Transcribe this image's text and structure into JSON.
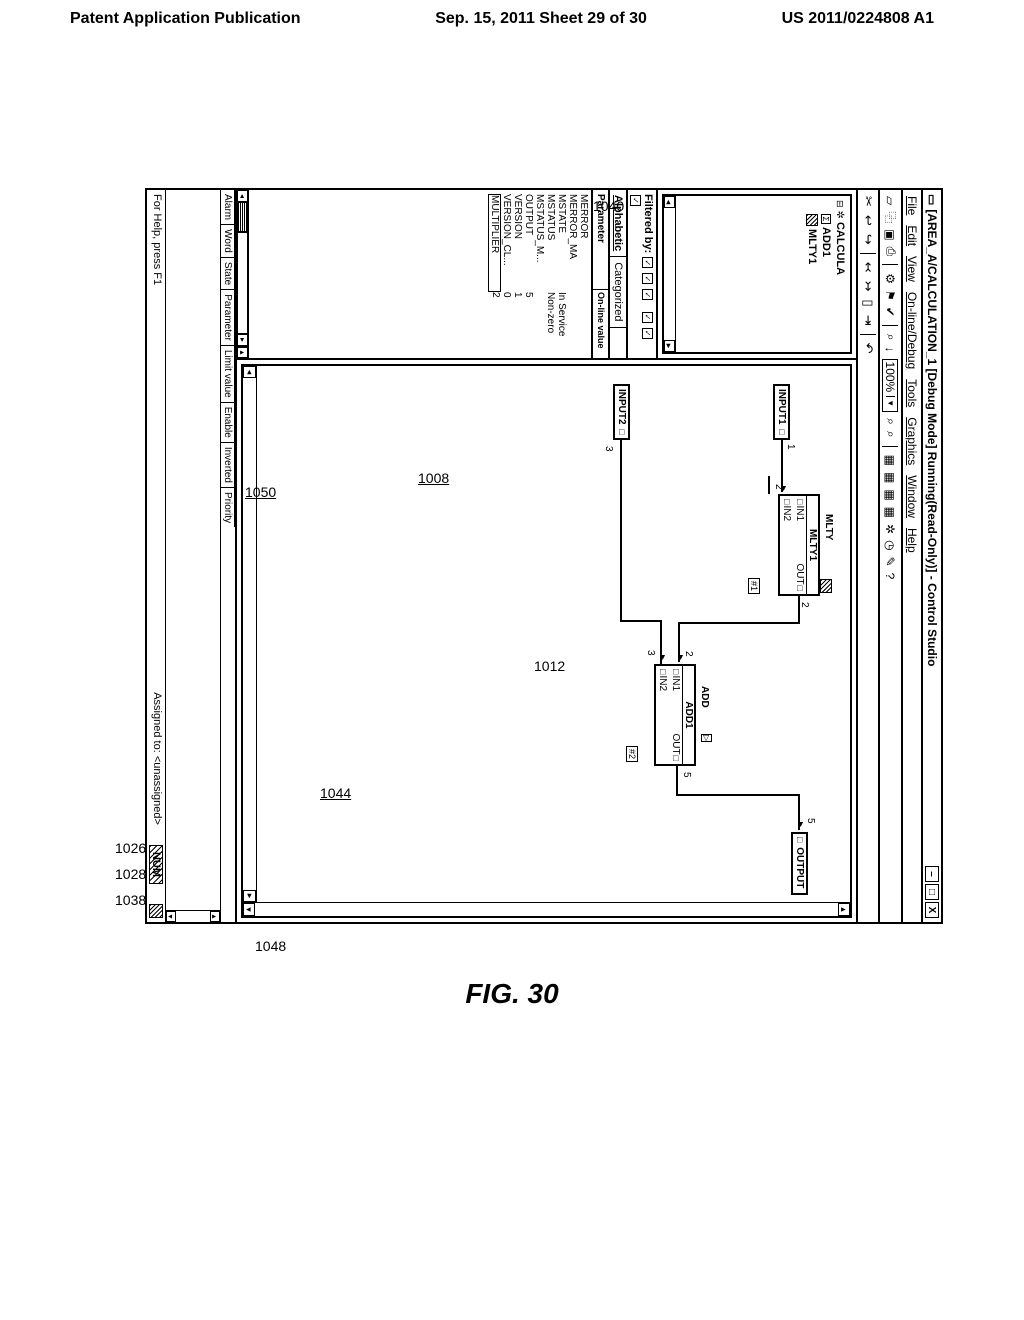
{
  "page_header": {
    "left": "Patent Application Publication",
    "center": "Sep. 15, 2011  Sheet 29 of 30",
    "right": "US 2011/0224808 A1"
  },
  "figure_label": "FIG. 30",
  "annotations": {
    "top": "1040",
    "a1026": "1026",
    "a1028": "1028",
    "a1038": "1038",
    "a1048": "1048",
    "a1050": "1050",
    "a1008": "1008",
    "a1012": "1012",
    "a1044": "1044"
  },
  "window": {
    "title": "[AREA_A/CALCULATION_1 [Debug Mode] Running(Read-Only)] - Control Studio",
    "menu": [
      "File",
      "Edit",
      "View",
      "On-line/Debug",
      "Tools",
      "Graphics",
      "Window",
      "Help"
    ],
    "zoom": "100%"
  },
  "tree": {
    "root": "CALCULA",
    "n1_box": "Σ",
    "n1": "ADD1",
    "n2": "MLTY1"
  },
  "filter": {
    "label": "Filtered by:"
  },
  "cattabs": {
    "t1": "Alphabetic",
    "t2": "Categorized"
  },
  "param_head": {
    "c1": "Parameter",
    "c2": "On-line value"
  },
  "params": [
    {
      "nm": "MERROR",
      "vl": ""
    },
    {
      "nm": "MERROR_MA",
      "vl": ""
    },
    {
      "nm": "MSTATE",
      "vl": "In Service"
    },
    {
      "nm": "MSTATUS",
      "vl": "Non-zero"
    },
    {
      "nm": "MSTATUS_M...",
      "vl": ""
    },
    {
      "nm": "OUTPUT",
      "vl": "5"
    },
    {
      "nm": "VERSION",
      "vl": "1"
    },
    {
      "nm": "VERSION_CL...",
      "vl": "0"
    },
    {
      "nm": "MULTIPLIER",
      "vl": "2"
    }
  ],
  "canvas": {
    "input1": "INPUT1",
    "input2": "INPUT2",
    "mlty_t": "MLTY",
    "mlty": "MLTY1",
    "mlty_in1": "IN1",
    "mlty_in2": "IN2",
    "mlty_out": "OUT",
    "add_t": "ADD",
    "add": "ADD1",
    "add_in1": "IN1",
    "add_in2": "IN2",
    "add_out": "OUT",
    "output": "OUTPUT",
    "n1": "1",
    "n2": "2",
    "n3": "3",
    "n4": "5",
    "h1": "#1",
    "h2": "#2",
    "nOut2": "2",
    "nOut5": "5"
  },
  "low_cols": [
    "Alarm",
    "Word",
    "State",
    "Parameter",
    "Limit value",
    "Enable",
    "Inverted",
    "Priority"
  ],
  "status": {
    "left": "For Help, press F1",
    "mid": "Assigned to:  <unassigned>",
    "right": "NUM"
  }
}
